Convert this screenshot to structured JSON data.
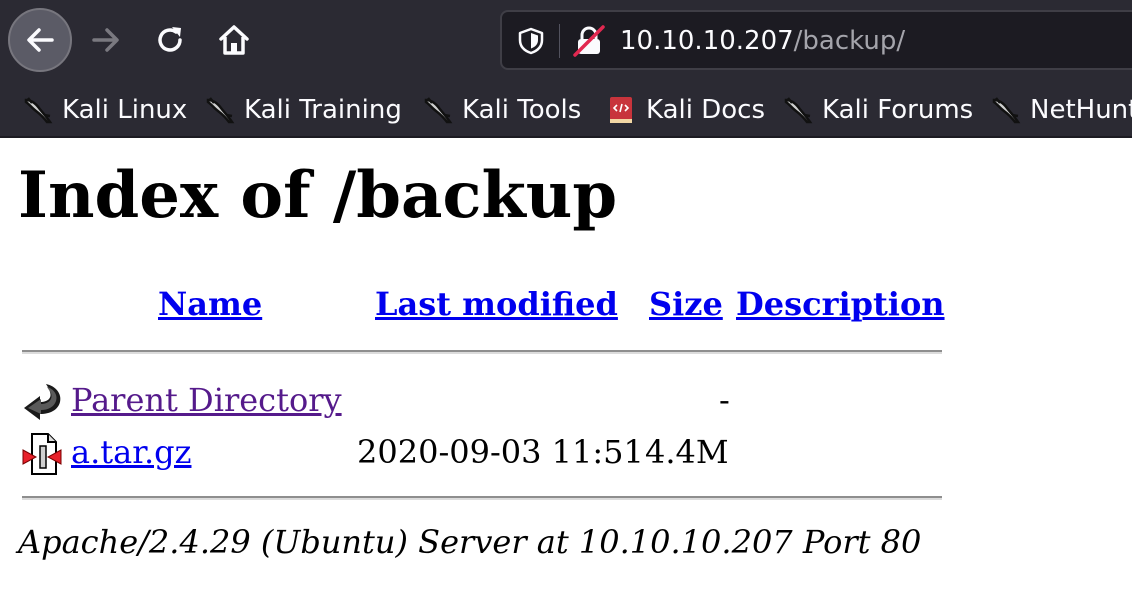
{
  "browser": {
    "url_host": "10.10.10.207",
    "url_path": "/backup/",
    "bookmarks": [
      {
        "label": "Kali Linux",
        "icon": "kali-dragon-icon"
      },
      {
        "label": "Kali Training",
        "icon": "kali-dragon-icon"
      },
      {
        "label": "Kali Tools",
        "icon": "kali-dragon-icon"
      },
      {
        "label": "Kali Docs",
        "icon": "kali-docs-book-icon"
      },
      {
        "label": "Kali Forums",
        "icon": "kali-dragon-icon"
      },
      {
        "label": "NetHunt",
        "icon": "kali-dragon-icon"
      }
    ]
  },
  "page": {
    "title": "Index of /backup",
    "columns": {
      "name": "Name",
      "last_modified": "Last modified",
      "size": "Size",
      "description": "Description"
    },
    "rows": [
      {
        "name": "Parent Directory",
        "modified": "",
        "size": "-",
        "description": "",
        "icon": "back-arrow-icon"
      },
      {
        "name": "a.tar.gz",
        "modified": "2020-09-03 11:51",
        "size": "4.4M",
        "description": "",
        "icon": "compressed-file-icon"
      }
    ],
    "footer": "Apache/2.4.29 (Ubuntu) Server at 10.10.10.207 Port 80"
  },
  "colors": {
    "chrome_bg": "#2b2a33",
    "link": "#0000ee",
    "visited_link": "#551a8b"
  }
}
